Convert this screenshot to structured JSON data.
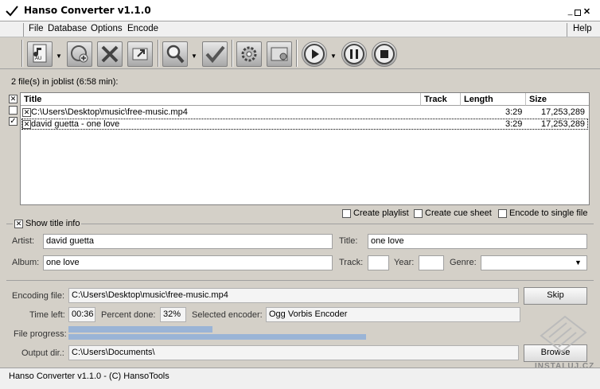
{
  "window": {
    "title": "Hanso Converter v1.1.0"
  },
  "menu": {
    "items": [
      "File",
      "Database",
      "Options",
      "Encode"
    ],
    "help": "Help"
  },
  "toolbar": {
    "icons": [
      "add-audio-file-icon",
      "add-url-icon",
      "remove-icon",
      "export-icon",
      "search-icon",
      "check-icon",
      "settings-icon",
      "encoder-settings-icon",
      "play-icon",
      "pause-icon",
      "stop-icon"
    ]
  },
  "joblist": {
    "info": "2 file(s) in joblist (6:58 min):",
    "columns": {
      "title": "Title",
      "track": "Track",
      "length": "Length",
      "size": "Size"
    },
    "rows": [
      {
        "title": "C:\\Users\\Desktop\\music\\free-music.mp4",
        "track": "",
        "length": "3:29",
        "size": "17,253,289"
      },
      {
        "title": "david guetta - one love",
        "track": "",
        "length": "3:29",
        "size": "17,253,289"
      }
    ]
  },
  "options": {
    "create_playlist": "Create playlist",
    "create_cue": "Create cue sheet",
    "encode_single": "Encode to single file"
  },
  "titleinfo": {
    "show_label": "Show title info",
    "artist_label": "Artist:",
    "artist": "david guetta",
    "title_label": "Title:",
    "title": "one love",
    "album_label": "Album:",
    "album": "one love",
    "track_label": "Track:",
    "track": "",
    "year_label": "Year:",
    "year": "",
    "genre_label": "Genre:",
    "genre": ""
  },
  "encoding": {
    "file_label": "Encoding file:",
    "file": "C:\\Users\\Desktop\\music\\free-music.mp4",
    "skip": "Skip",
    "time_left_label": "Time left:",
    "time_left": "00:36",
    "percent_label": "Percent done:",
    "percent": "32%",
    "encoder_label": "Selected encoder:",
    "encoder": "Ogg Vorbis Encoder",
    "progress_label": "File progress:",
    "file_progress": 0.32,
    "total_progress": 0.66,
    "output_label": "Output dir.:",
    "output": "C:\\Users\\Documents\\",
    "browse": "Browse"
  },
  "status": {
    "text": "Hanso Converter v1.1.0 - (C) HansoTools"
  },
  "watermark": {
    "text": "INSTALUJ.CZ"
  }
}
